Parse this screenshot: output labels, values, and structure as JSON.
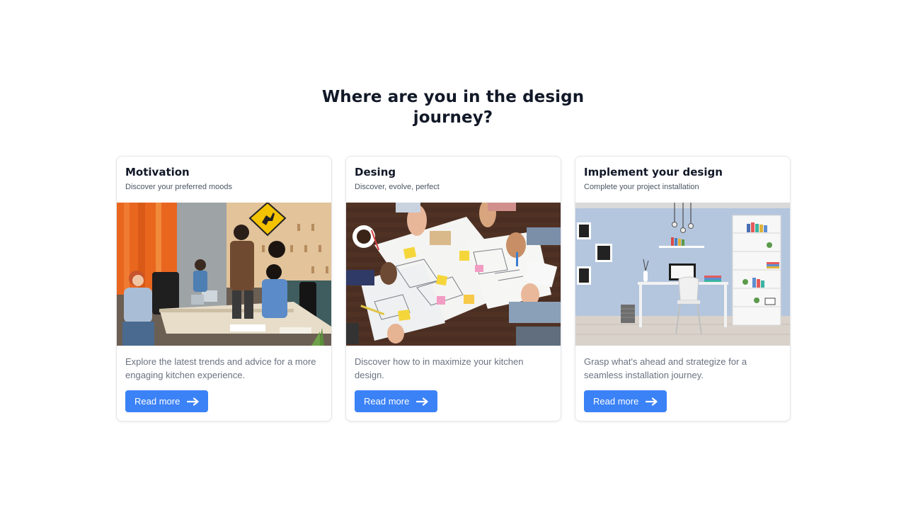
{
  "section": {
    "heading_line1": "Where are you in the design",
    "heading_line2": "journey?"
  },
  "cards": [
    {
      "title": "Motivation",
      "subtitle": "Discover your preferred moods",
      "image": "office-team-meeting-photo",
      "description": "Explore the latest trends and advice for a more engaging kitchen experience.",
      "button_label": "Read more",
      "button_icon": "arrow-right-icon"
    },
    {
      "title": "Desing",
      "subtitle": "Discover, evolve, perfect",
      "image": "hands-over-design-sketches-photo",
      "description": "Discover how to in maximize your kitchen design.",
      "button_label": "Read more",
      "button_icon": "arrow-right-icon"
    },
    {
      "title": "Implement your design",
      "subtitle": "Complete your project installation",
      "image": "minimal-home-office-interior-photo",
      "description": "Grasp what's ahead and strategize for a seamless installation journey.",
      "button_label": "Read more",
      "button_icon": "arrow-right-icon"
    }
  ],
  "colors": {
    "accent": "#3b82f6",
    "heading": "#111827",
    "body_text": "#6b7280",
    "card_border": "#e5e7eb"
  }
}
